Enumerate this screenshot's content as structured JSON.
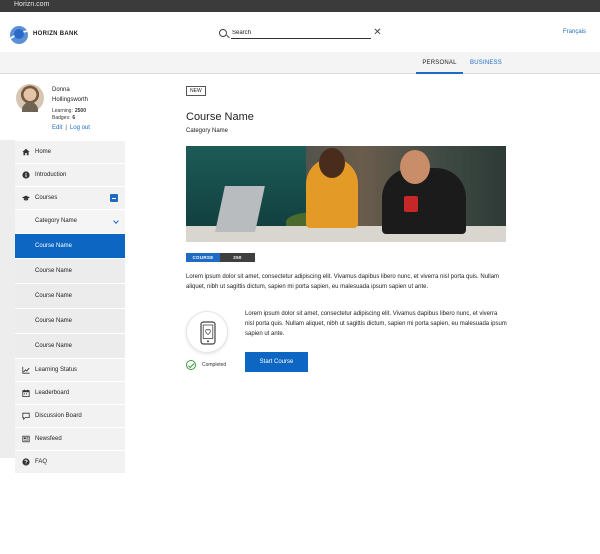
{
  "browser": {
    "url": "Horizn.com"
  },
  "header": {
    "brand": "HORIZN BANK",
    "search": {
      "value": "Search",
      "placeholder": "Search"
    },
    "language": "Français"
  },
  "nav": {
    "tabs": [
      {
        "label": "PERSONAL",
        "active": true
      },
      {
        "label": "BUSINESS",
        "active": false
      }
    ]
  },
  "profile": {
    "first_name": "Donna",
    "last_name": "Hollingsworth",
    "learning_label": "Learning:",
    "learning_value": "2500",
    "badges_label": "Badges:",
    "badges_value": "6",
    "edit": "Edit",
    "separator": "|",
    "logout": "Log out"
  },
  "sidebar": {
    "items": [
      {
        "label": "Home",
        "icon": "home-icon"
      },
      {
        "label": "Introduction",
        "icon": "info-icon"
      },
      {
        "label": "Courses",
        "icon": "graduation-cap-icon"
      },
      {
        "label": "Category Name"
      },
      {
        "label": "Course Name",
        "active": true
      },
      {
        "label": "Course Name"
      },
      {
        "label": "Course Name"
      },
      {
        "label": "Course Name"
      },
      {
        "label": "Course Name"
      },
      {
        "label": "Learning Status",
        "icon": "chart-line-icon"
      },
      {
        "label": "Leaderboard",
        "icon": "calendar-icon"
      },
      {
        "label": "Discussion Board",
        "icon": "chat-icon"
      },
      {
        "label": "Newsfeed",
        "icon": "newspaper-icon"
      },
      {
        "label": "FAQ",
        "icon": "question-icon"
      }
    ]
  },
  "course": {
    "badge": "NEW",
    "title": "Course Name",
    "category": "Category Name",
    "tag_type": "COURSE",
    "tag_points": "250 POINTS",
    "description": "Lorem ipsum dolor sit amet, consectetur adipiscing elit. Vivamus dapibus libero nunc, et viverra nisl porta quis. Nullam aliquet, nibh ut sagittis dictum, sapien mi porta sapien, eu malesuada ipsum sapien ut ante.",
    "description2": "Lorem ipsum dolor sit amet, consectetur adipiscing elit. Vivamus dapibus libero nunc, et viverra nisl porta quis. Nullam aliquet, nibh ut sagittis dictum, sapien mi porta sapien, eu malesuada ipsum sapien ut ante.",
    "status": "Completed",
    "start_button": "Start Course"
  },
  "colors": {
    "accent": "#0d66c2",
    "link": "#1f6bc4",
    "success": "#3b9b3b",
    "topbar": "#3b3b3b"
  }
}
